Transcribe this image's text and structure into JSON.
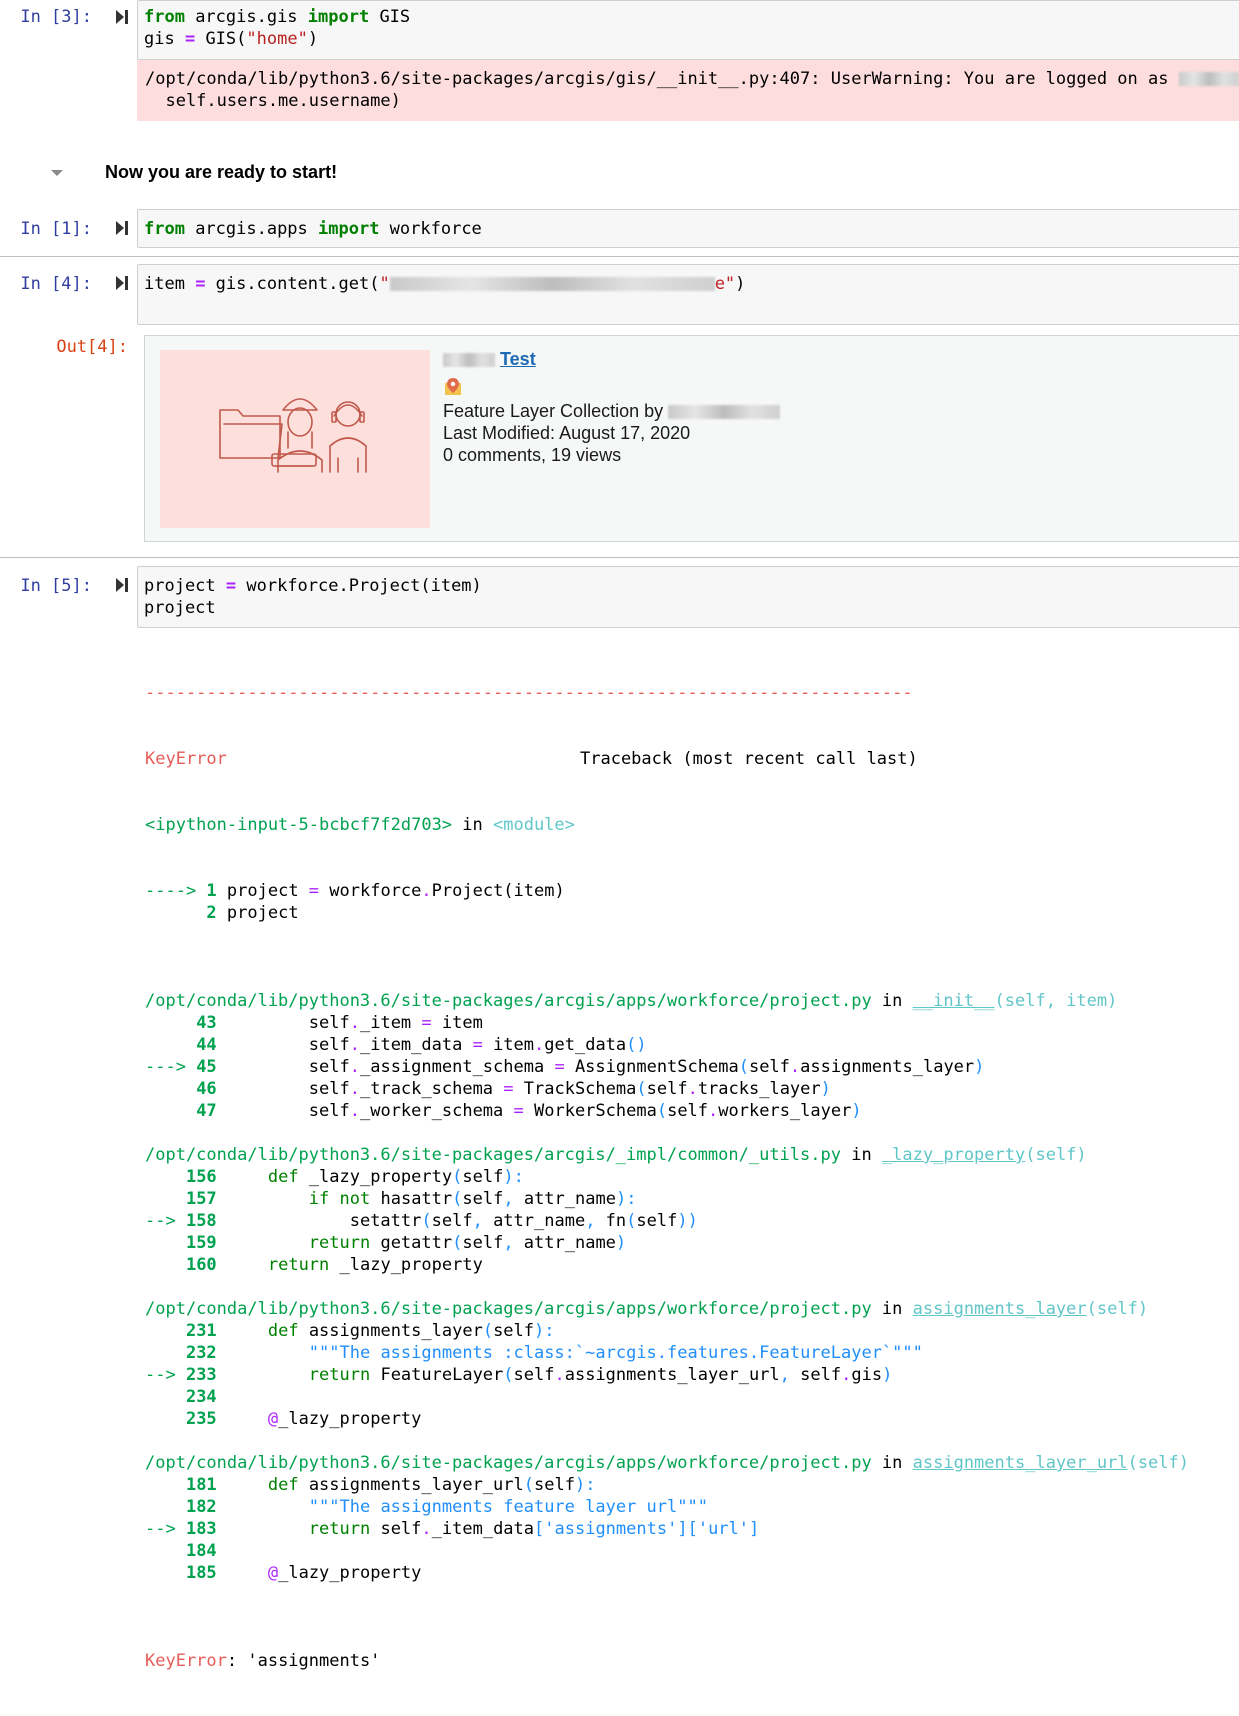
{
  "cell3": {
    "prompt": "In [3]:",
    "line1": {
      "kw1": "from",
      "mod": " arcgis.gis ",
      "kw2": "import",
      "name": " GIS"
    },
    "line2": {
      "var": "gis ",
      "op": "=",
      "call": " GIS(",
      "str": "\"home\"",
      "close": ")"
    },
    "stderr_line1": "/opt/conda/lib/python3.6/site-packages/arcgis/gis/__init__.py:407: UserWarning: You are logged on as",
    "stderr_line2": "  self.users.me.username)"
  },
  "markdown": {
    "text": "Now you are ready to start!"
  },
  "cell1": {
    "prompt": "In [1]:",
    "line1": {
      "kw1": "from",
      "mod": " arcgis.apps ",
      "kw2": "import",
      "name": " workforce"
    }
  },
  "cell4": {
    "prompt": "In [4]:",
    "line1": {
      "var": "item ",
      "op": "=",
      "call": " gis.content.get(",
      "str_open": "\"",
      "str_close": "e\"",
      "close": ")"
    },
    "out_prompt": "Out[4]:",
    "card": {
      "title": "Test",
      "type_line": "Feature Layer Collection by",
      "modified": "Last Modified: August 17, 2020",
      "stats": "0 comments, 19 views",
      "icon": "map-pin-icon",
      "thumb_icon": "workforce-illustration-icon"
    }
  },
  "cell5": {
    "prompt": "In [5]:",
    "line1": {
      "var": "project ",
      "op": "=",
      "call": " workforce.Project(item)"
    },
    "line2": "project"
  },
  "traceback": {
    "dashes": "---------------------------------------------------------------------------",
    "error_name": "KeyError",
    "header_right": "Traceback (most recent call last)",
    "input_name": "<ipython-input-5-bcbcf7f2d703>",
    "in_word": " in ",
    "module": "<module>",
    "f0": [
      {
        "arrow": "----> ",
        "num": "1",
        "code": " project = workforce.Project(item)"
      },
      {
        "arrow": "      ",
        "num": "2",
        "code": " project"
      }
    ],
    "frames": [
      {
        "path": "/opt/conda/lib/python3.6/site-packages/arcgis/apps/workforce/project.py",
        "func": "__init__",
        "args": "(self, item)",
        "lines": [
          {
            "arrow": "     ",
            "num": "43",
            "code": "         self._item = item"
          },
          {
            "arrow": "     ",
            "num": "44",
            "code": "         self._item_data = item.get_data()"
          },
          {
            "arrow": "---> ",
            "num": "45",
            "code": "         self._assignment_schema = AssignmentSchema(self.assignments_layer)"
          },
          {
            "arrow": "     ",
            "num": "46",
            "code": "         self._track_schema = TrackSchema(self.tracks_layer)"
          },
          {
            "arrow": "     ",
            "num": "47",
            "code": "         self._worker_schema = WorkerSchema(self.workers_layer)"
          }
        ]
      },
      {
        "path": "/opt/conda/lib/python3.6/site-packages/arcgis/_impl/common/_utils.py",
        "func": "_lazy_property",
        "args": "(self)",
        "lines": [
          {
            "arrow": "    ",
            "num": "156",
            "code": "     def _lazy_property(self):"
          },
          {
            "arrow": "    ",
            "num": "157",
            "code": "         if not hasattr(self, attr_name):"
          },
          {
            "arrow": "--> ",
            "num": "158",
            "code": "             setattr(self, attr_name, fn(self))"
          },
          {
            "arrow": "    ",
            "num": "159",
            "code": "         return getattr(self, attr_name)"
          },
          {
            "arrow": "    ",
            "num": "160",
            "code": "     return _lazy_property"
          }
        ]
      },
      {
        "path": "/opt/conda/lib/python3.6/site-packages/arcgis/apps/workforce/project.py",
        "func": "assignments_layer",
        "args": "(self)",
        "lines": [
          {
            "arrow": "    ",
            "num": "231",
            "code": "     def assignments_layer(self):"
          },
          {
            "arrow": "    ",
            "num": "232",
            "code": "         \"\"\"The assignments :class:`~arcgis.features.FeatureLayer`\"\"\""
          },
          {
            "arrow": "--> ",
            "num": "233",
            "code": "         return FeatureLayer(self.assignments_layer_url, self.gis)"
          },
          {
            "arrow": "    ",
            "num": "234",
            "code": ""
          },
          {
            "arrow": "    ",
            "num": "235",
            "code": "     @_lazy_property"
          }
        ]
      },
      {
        "path": "/opt/conda/lib/python3.6/site-packages/arcgis/apps/workforce/project.py",
        "func": "assignments_layer_url",
        "args": "(self)",
        "lines": [
          {
            "arrow": "    ",
            "num": "181",
            "code": "     def assignments_layer_url(self):"
          },
          {
            "arrow": "    ",
            "num": "182",
            "code": "         \"\"\"The assignments feature layer url\"\"\""
          },
          {
            "arrow": "--> ",
            "num": "183",
            "code": "         return self._item_data['assignments']['url']"
          },
          {
            "arrow": "    ",
            "num": "184",
            "code": ""
          },
          {
            "arrow": "    ",
            "num": "185",
            "code": "     @_lazy_property"
          }
        ]
      }
    ],
    "final_error": "KeyError",
    "final_msg": ": 'assignments'"
  }
}
